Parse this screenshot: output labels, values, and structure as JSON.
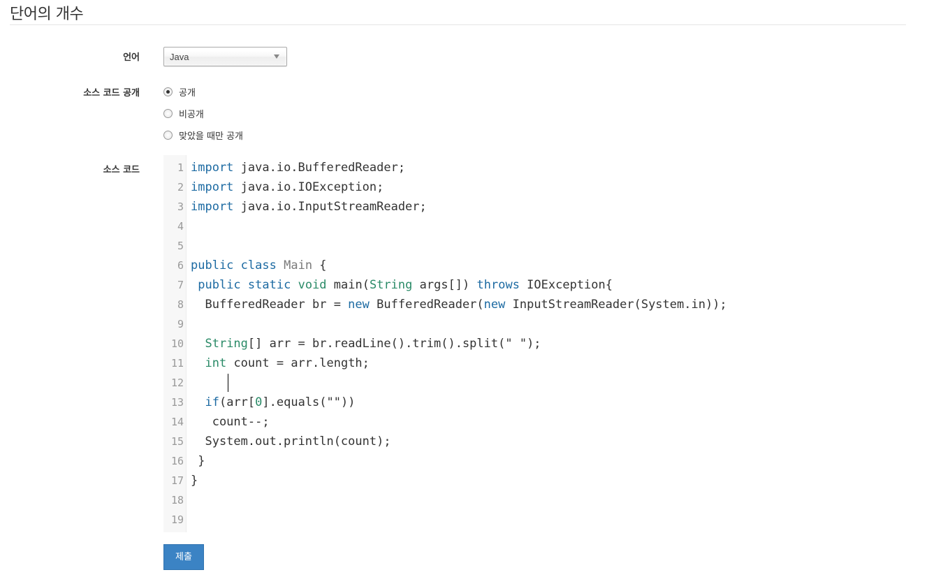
{
  "page": {
    "title": "단어의 개수"
  },
  "form": {
    "language_label": "언어",
    "language_value": "Java",
    "visibility_label": "소스 코드 공개",
    "visibility_options": [
      "공개",
      "비공개",
      "맞았을 때만 공개"
    ],
    "visibility_selected": "공개",
    "code_label": "소스 코드",
    "submit_label": "제출"
  },
  "editor": {
    "lines": [
      {
        "n": "1"
      },
      {
        "n": "2"
      },
      {
        "n": "3"
      },
      {
        "n": "4"
      },
      {
        "n": "5"
      },
      {
        "n": "6"
      },
      {
        "n": "7"
      },
      {
        "n": "8"
      },
      {
        "n": "9"
      },
      {
        "n": "10"
      },
      {
        "n": "11"
      },
      {
        "n": "12"
      },
      {
        "n": "13"
      },
      {
        "n": "14"
      },
      {
        "n": "15"
      },
      {
        "n": "16"
      },
      {
        "n": "17"
      },
      {
        "n": "18"
      },
      {
        "n": "19"
      }
    ],
    "tokens": {
      "import": "import",
      "l1": " java.io.BufferedReader;",
      "l2": " java.io.IOException;",
      "l3": " java.io.InputStreamReader;",
      "public": "public",
      "class": "class",
      "main_cls": "Main",
      "l6_tail": " {",
      "static": "static",
      "void": "void",
      "main_sig": " main(",
      "String": "String",
      "args": " args[]) ",
      "throws": "throws",
      "ioexc": " IOException{",
      "l8a": "  BufferedReader br = ",
      "new": "new",
      "l8b": " BufferedReader(",
      "l8c": " InputStreamReader(System.in));",
      "l10a": "[] arr = br.readLine().trim().split(\" \");",
      "int": "int",
      "l11": " count = arr.length;",
      "if": "if",
      "l13a": "(arr[",
      "zero": "0",
      "l13b": "].equals(\"\"))",
      "l14": "   count--;",
      "l15": "  System.out.println(count);",
      "l16": " }",
      "l17": "}"
    }
  },
  "colors": {
    "accent": "#3b83c4",
    "keyword": "#1c6aa2",
    "type": "#2a8a67"
  }
}
